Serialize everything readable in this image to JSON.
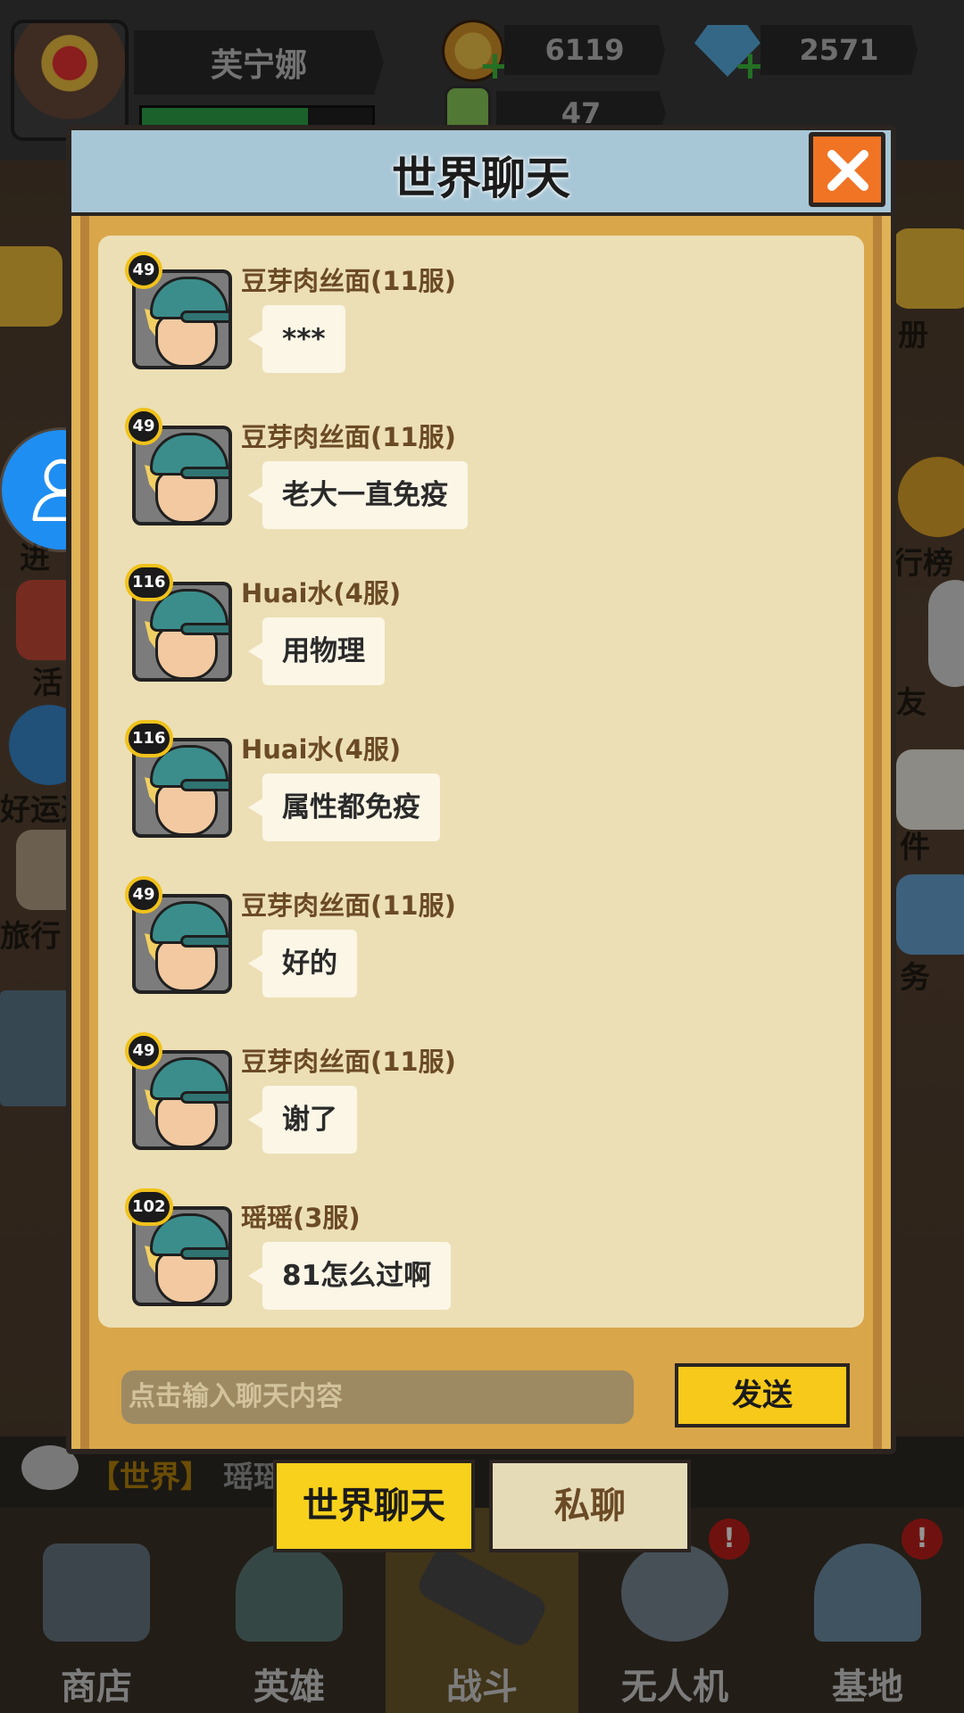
{
  "topbar": {
    "player_name": "芙宁娜",
    "hp_fraction": 0.72,
    "coins": "6119",
    "gems": "2571",
    "energy": "47"
  },
  "side_labels": {
    "left": [
      "进",
      "活",
      "好运这",
      "旅行"
    ],
    "right": [
      "册",
      "行榜",
      "友",
      "件",
      "务"
    ]
  },
  "ticker": {
    "channel": "【世界】",
    "speaker": "瑶瑶"
  },
  "bottom_nav": {
    "items": [
      {
        "label": "商店",
        "icon": "shop-icon",
        "alert": false
      },
      {
        "label": "英雄",
        "icon": "hero-icon",
        "alert": false
      },
      {
        "label": "战斗",
        "icon": "rifle-icon",
        "alert": false,
        "active": true
      },
      {
        "label": "无人机",
        "icon": "drone-icon",
        "alert": true
      },
      {
        "label": "基地",
        "icon": "base-icon",
        "alert": true
      }
    ],
    "alert_symbol": "!"
  },
  "dialog": {
    "title": "世界聊天",
    "messages": [
      {
        "level": "49",
        "name": "豆芽肉丝面(11服)",
        "text": "***"
      },
      {
        "level": "49",
        "name": "豆芽肉丝面(11服)",
        "text": "老大一直免疫"
      },
      {
        "level": "116",
        "name": "Huai水(4服)",
        "text": "用物理"
      },
      {
        "level": "116",
        "name": "Huai水(4服)",
        "text": "属性都免疫"
      },
      {
        "level": "49",
        "name": "豆芽肉丝面(11服)",
        "text": "好的"
      },
      {
        "level": "49",
        "name": "豆芽肉丝面(11服)",
        "text": "谢了"
      },
      {
        "level": "102",
        "name": "瑶瑶(3服)",
        "text": "81怎么过啊"
      }
    ],
    "input_placeholder": "点击输入聊天内容",
    "send_label": "发送"
  },
  "tabs": {
    "world": "世界聊天",
    "private": "私聊"
  },
  "colors": {
    "accent_yellow": "#f8d11c",
    "close_orange": "#f07424",
    "float_button_blue": "#1e8ef2"
  }
}
